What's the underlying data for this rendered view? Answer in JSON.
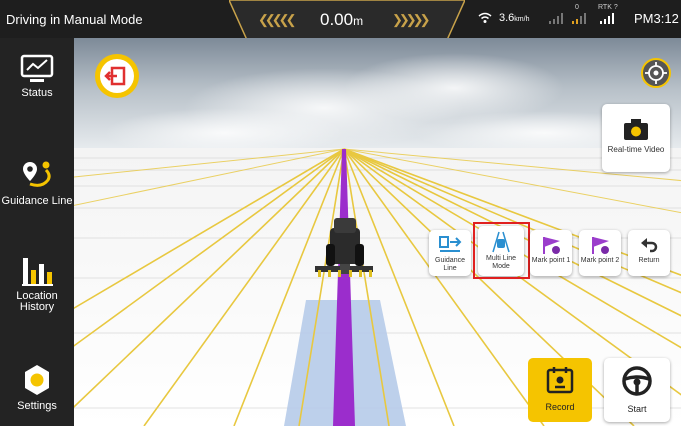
{
  "topbar": {
    "mode_title": "Driving in Manual Mode",
    "distance_value": "0.00",
    "distance_unit": "m",
    "speed_value": "3.6",
    "speed_unit": "km/h",
    "satellite_count": "0",
    "rtk_label": "RTK",
    "rtk_count": "?",
    "time": "PM3:12"
  },
  "sidebar": {
    "items": [
      {
        "label": "Status",
        "icon": "status-monitor-icon"
      },
      {
        "label": "Guidance Line",
        "icon": "guidance-route-icon"
      },
      {
        "label": "Location\nHistory",
        "icon": "bar-chart-icon"
      },
      {
        "label": "Settings",
        "icon": "gear-icon"
      }
    ]
  },
  "scene": {
    "exit_icon": "exit-icon",
    "locate_icon": "crosshair-icon",
    "realtime_video_label": "Real-time Video",
    "tools": [
      {
        "label": "Guidance Line",
        "icon": "guidance-line-icon"
      },
      {
        "label": "Multi Line Mode",
        "icon": "multi-line-icon"
      },
      {
        "label": "Mark point 1",
        "icon": "flag-1-icon"
      },
      {
        "label": "Mark point 2",
        "icon": "flag-2-icon"
      },
      {
        "label": "Return",
        "icon": "return-arrow-icon"
      }
    ],
    "record_label": "Record",
    "start_label": "Start"
  },
  "colors": {
    "accent_yellow": "#f5c400",
    "guidance_purple": "#9b2dcc",
    "line_yellow": "#e8c840",
    "highlight_red": "#e02020",
    "sidebar_bg": "#232323"
  }
}
